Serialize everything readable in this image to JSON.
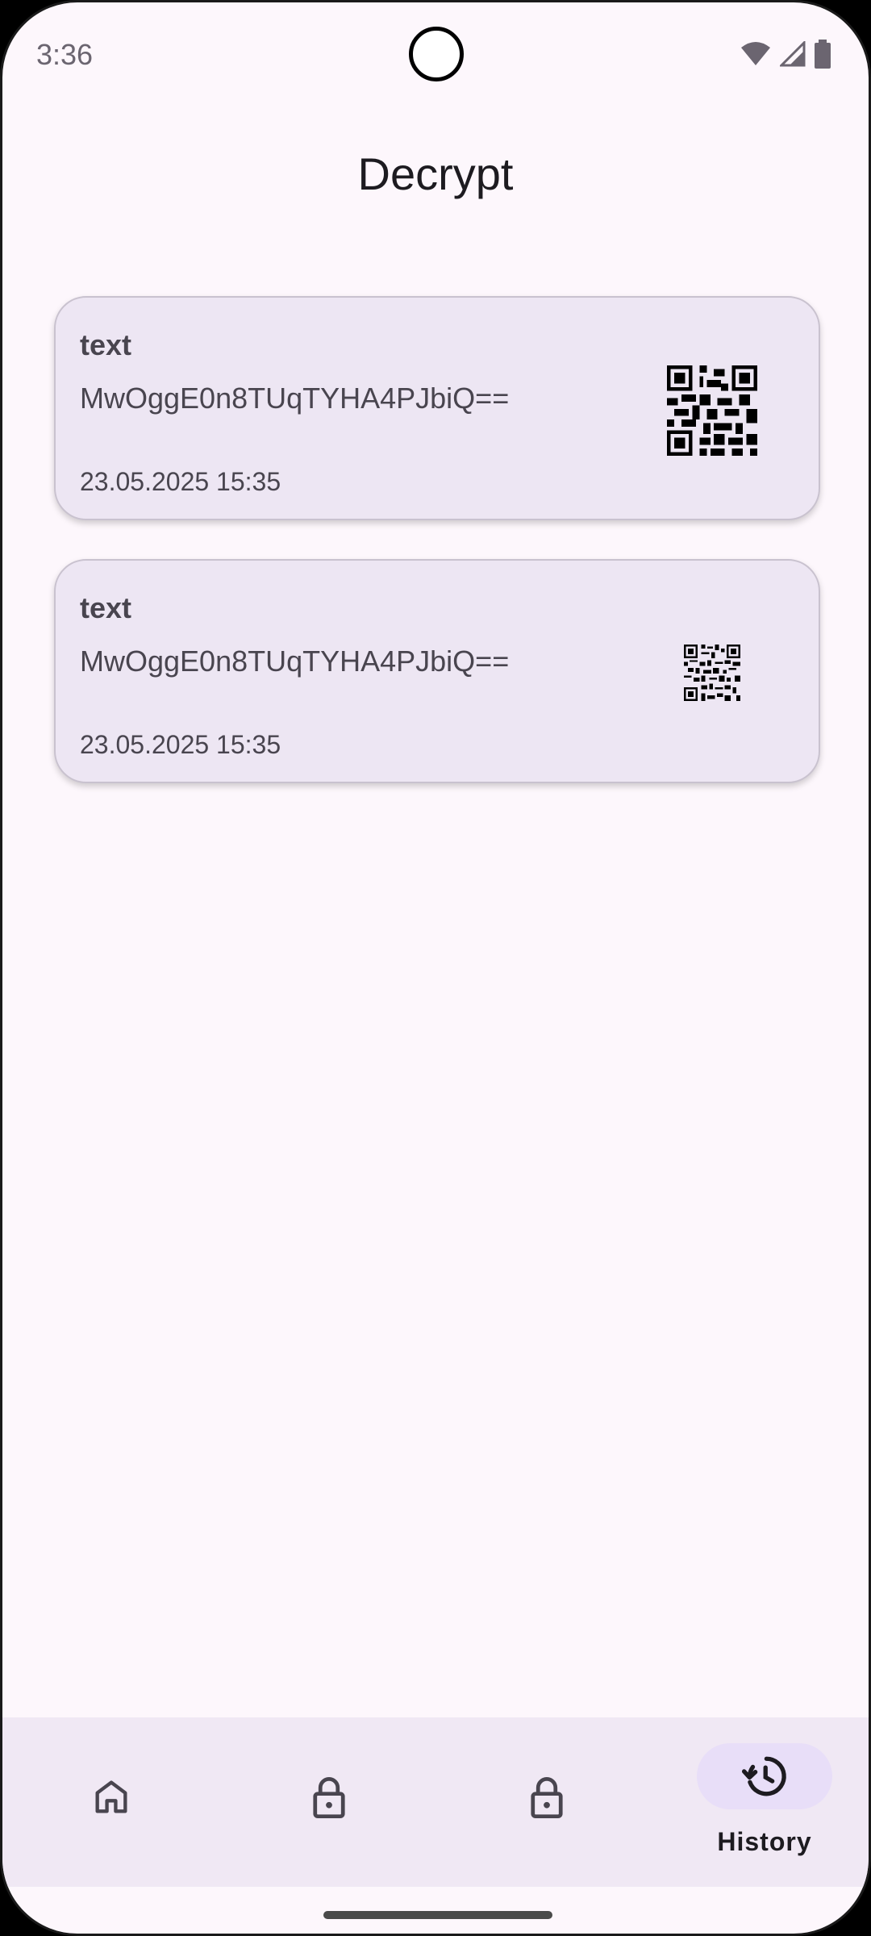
{
  "status_bar": {
    "time": "3:36",
    "icons": [
      "wifi-icon",
      "signal-icon",
      "battery-icon"
    ]
  },
  "header": {
    "title": "Decrypt"
  },
  "history_items": [
    {
      "type": "text",
      "value": "MwOggE0n8TUqTYHA4PJbiQ==",
      "date": "23.05.2025 15:35",
      "qr_icon": "qr-code-icon"
    },
    {
      "type": "text",
      "value": "MwOggE0n8TUqTYHA4PJbiQ==",
      "date": "23.05.2025 15:35",
      "qr_icon": "qr-code-icon"
    }
  ],
  "bottom_nav": {
    "items": [
      {
        "id": "home",
        "icon": "home-icon",
        "label": ""
      },
      {
        "id": "encrypt",
        "icon": "lock-icon",
        "label": ""
      },
      {
        "id": "decrypt",
        "icon": "lock-icon",
        "label": ""
      },
      {
        "id": "history",
        "icon": "history-icon",
        "label": "History",
        "selected": true
      }
    ]
  },
  "colors": {
    "background": "#fdf7fc",
    "card": "#ede6f3",
    "nav_bar": "#f0e8f4",
    "nav_indicator": "#e8def8",
    "text_primary": "#1d1b20",
    "text_secondary": "#49454f"
  }
}
